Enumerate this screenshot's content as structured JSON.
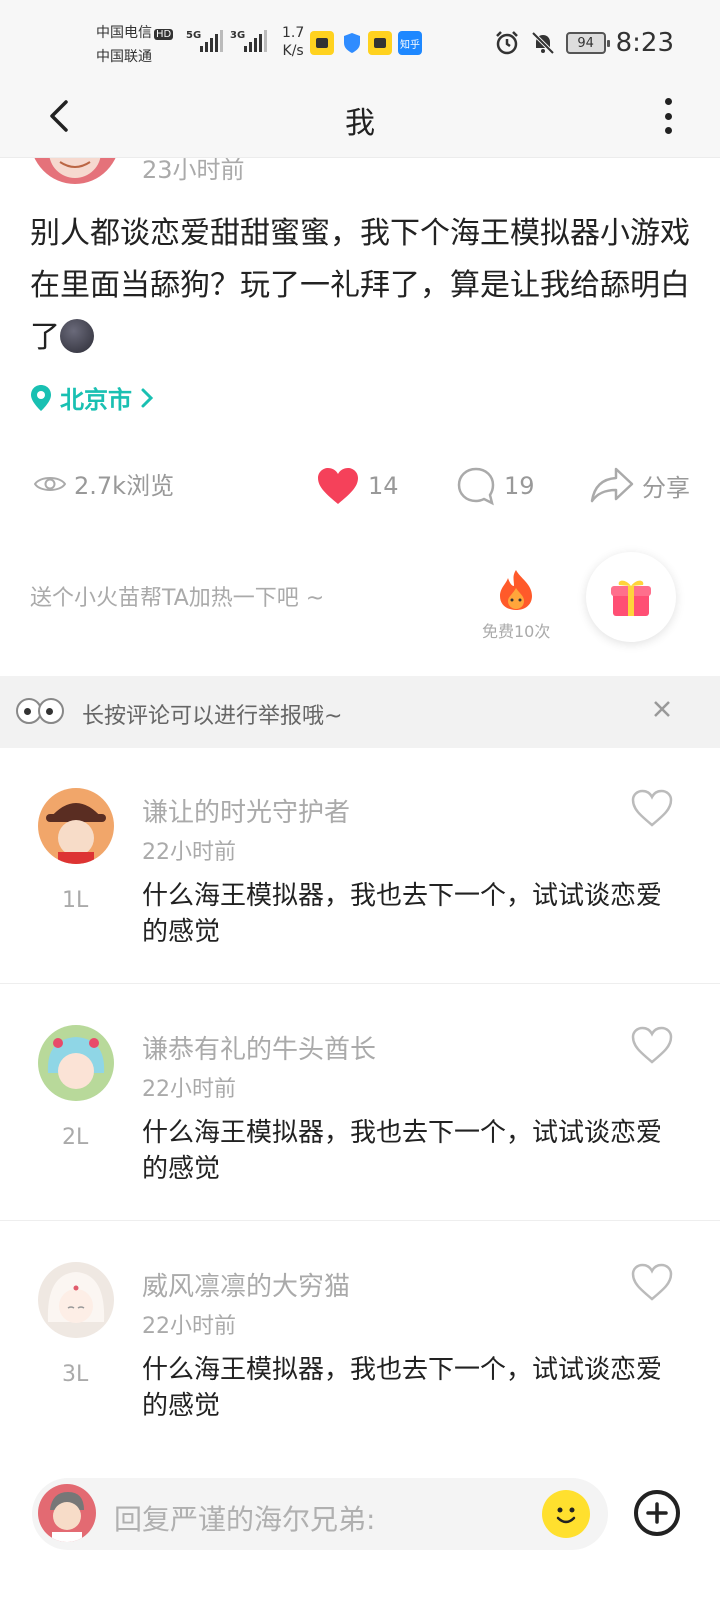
{
  "status_bar": {
    "carrier1": "中国电信",
    "carrier1_badge": "HD",
    "carrier2": "中国联通",
    "sig1": "5G",
    "sig2": "3G",
    "speed_value": "1.7",
    "speed_unit": "K/s",
    "app_icons": [
      "meituan-icon",
      "shield-icon",
      "meituan-icon",
      "zhihu-icon"
    ],
    "zhihu_label": "知乎",
    "battery": "94",
    "time": "8:23"
  },
  "nav": {
    "title": "我"
  },
  "post": {
    "time_partial": "23小时前",
    "text": "别人都谈恋爱甜甜蜜蜜，我下个海王模拟器小游戏在里面当舔狗？玩了一礼拜了，算是让我给舔明白了",
    "location": "北京市",
    "views": "2.7k浏览",
    "likes": "14",
    "comments": "19",
    "share": "分享",
    "fire_prompt": "送个小火苗帮TA加热一下吧 ~",
    "fire_free": "免费10次"
  },
  "notice": {
    "text": "长按评论可以进行举报哦~"
  },
  "comments": [
    {
      "name": "谦让的时光守护者",
      "time": "22小时前",
      "floor": "1L",
      "text": "什么海王模拟器，我也去下一个，试试谈恋爱的感觉"
    },
    {
      "name": "谦恭有礼的牛头酋长",
      "time": "22小时前",
      "floor": "2L",
      "text": "什么海王模拟器，我也去下一个，试试谈恋爱的感觉"
    },
    {
      "name": "威风凛凛的大穷猫",
      "time": "22小时前",
      "floor": "3L",
      "text": "什么海王模拟器，我也去下一个，试试谈恋爱的感觉"
    }
  ],
  "reply": {
    "placeholder": "回复严谨的海尔兄弟:"
  },
  "colors": {
    "accent_teal": "#19c0b2",
    "like_red": "#f5415a",
    "emoji_yellow": "#ffe02e"
  }
}
